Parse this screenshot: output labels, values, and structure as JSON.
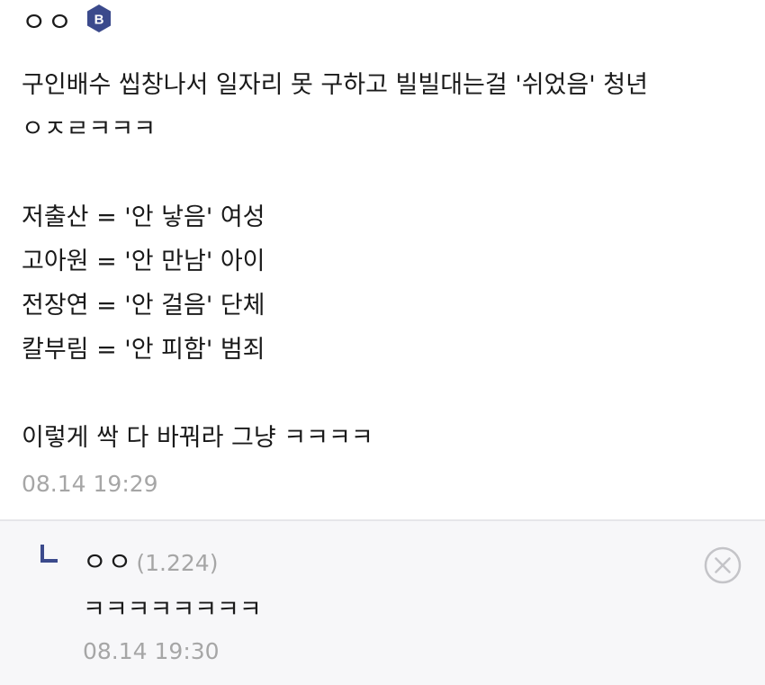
{
  "comment": {
    "author": "ㅇㅇ",
    "badge_letter": "B",
    "lines": [
      "구인배수 씹창나서 일자리 못 구하고 빌빌대는걸 '쉬었음' 청년",
      "ㅇㅈㄹㅋㅋㅋ",
      "",
      "저출산 = '안 낳음' 여성",
      "고아원 = '안 만남' 아이",
      "전장연 = '안 걸음' 단체",
      "칼부림 = '안 피함' 범죄",
      "",
      "이렇게 싹 다 바꿔라 그냥 ㅋㅋㅋㅋ"
    ],
    "timestamp": "08.14 19:29"
  },
  "reply": {
    "author": "ㅇㅇ",
    "score": "(1.224)",
    "text": "ㅋㅋㅋㅋㅋㅋㅋㅋ",
    "timestamp": "08.14 19:30"
  },
  "colors": {
    "badge": "#3b4a8c",
    "reply_arrow": "#3b4a8c",
    "muted_text": "#a6a6a6",
    "reply_background": "#f7f7f9"
  },
  "icons": {
    "badge": "hexagon-badge-icon",
    "reply_arrow": "reply-arrow-icon",
    "close": "close-circle-icon"
  }
}
